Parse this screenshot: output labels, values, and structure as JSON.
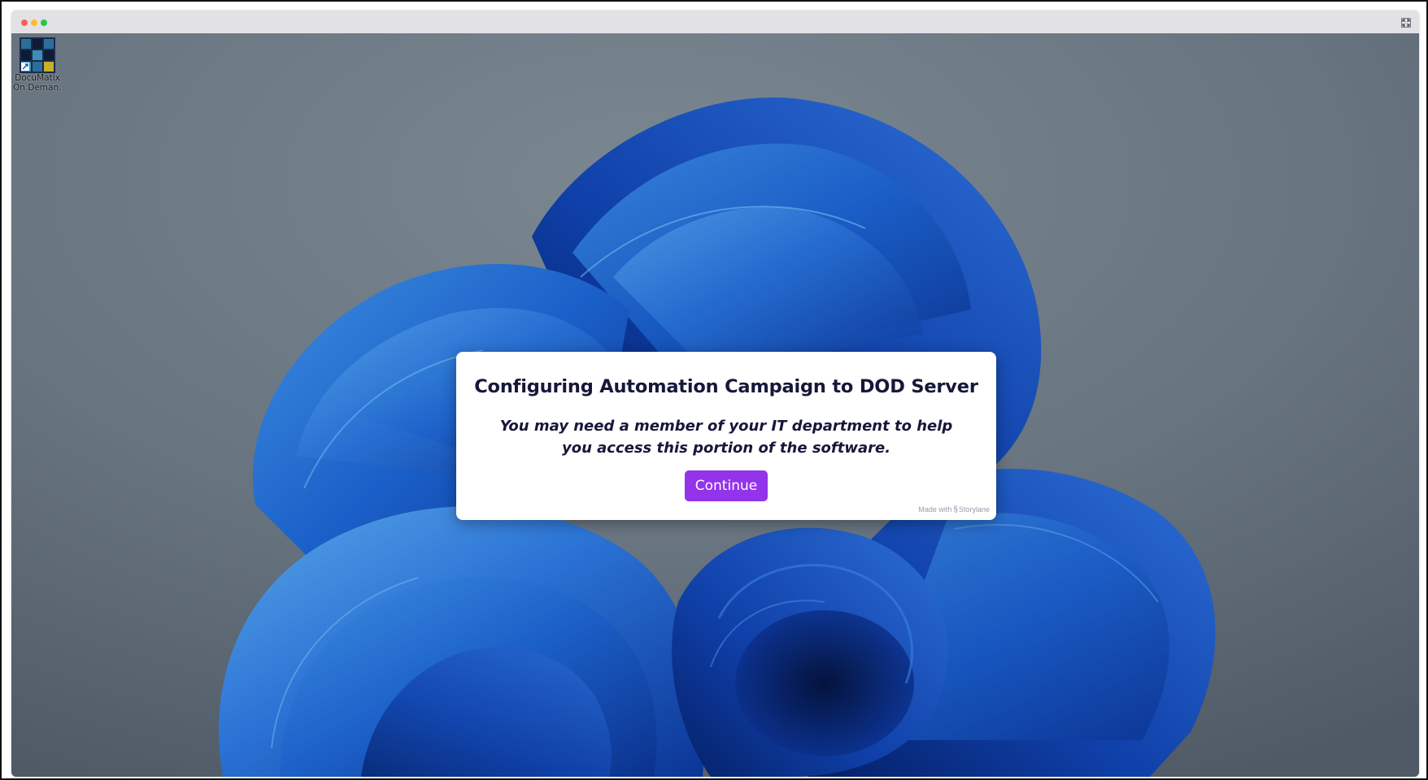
{
  "window": {
    "traffic_lights": {
      "close_color": "#ff5f57",
      "minimize_color": "#febc2e",
      "maximize_color": "#28c840"
    },
    "fullscreen_icon": "expand-icon"
  },
  "desktop": {
    "wallpaper": "windows-11-bloom",
    "icons": [
      {
        "label_line1": "DocuMatix",
        "label_line2": "On Deman...",
        "icon": "documatix-app-icon",
        "shortcut": true
      }
    ]
  },
  "modal": {
    "title": "Configuring Automation Campaign to DOD Server",
    "message": "You may need a member of your IT department to help you access this portion of the software.",
    "continue_label": "Continue",
    "button_color": "#9333ea",
    "branding_prefix": "Made with",
    "branding_name": "Storylane"
  }
}
